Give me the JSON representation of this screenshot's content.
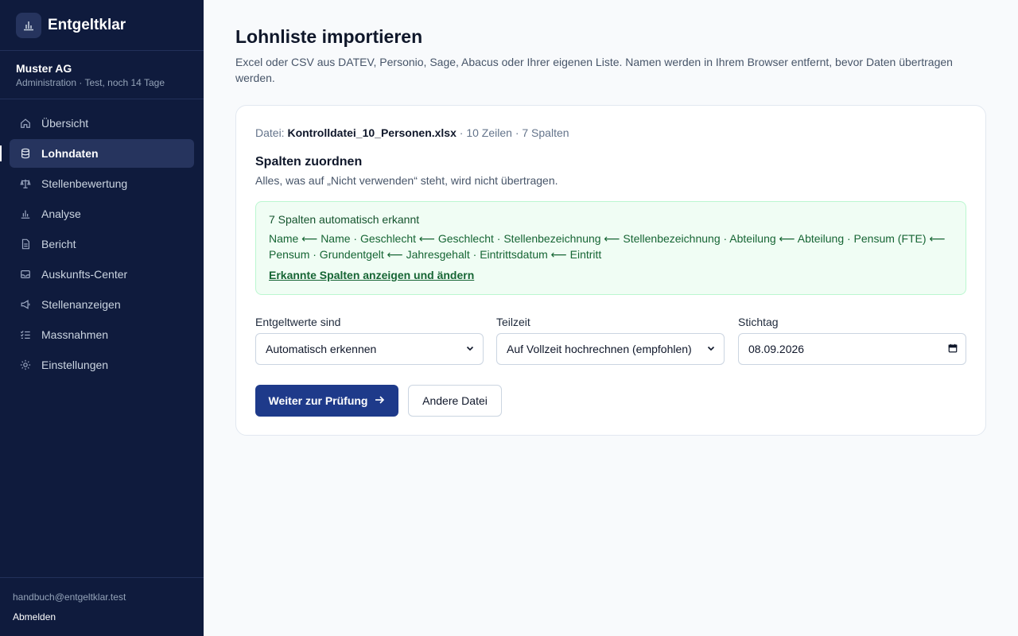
{
  "sidebar": {
    "brand": {
      "name": "Entgeltklar",
      "icon": "bar-chart-icon"
    },
    "org": {
      "name": "Muster AG",
      "subtitle": "Administration · Test, noch 14 Tage"
    },
    "items": [
      {
        "label": "Übersicht",
        "icon": "home-icon",
        "active": false
      },
      {
        "label": "Lohndaten",
        "icon": "database-icon",
        "active": true
      },
      {
        "label": "Stellenbewertung",
        "icon": "scale-icon",
        "active": false
      },
      {
        "label": "Analyse",
        "icon": "bar-chart-icon",
        "active": false
      },
      {
        "label": "Bericht",
        "icon": "document-icon",
        "active": false
      },
      {
        "label": "Auskunfts-Center",
        "icon": "inbox-icon",
        "active": false
      },
      {
        "label": "Stellenanzeigen",
        "icon": "megaphone-icon",
        "active": false
      },
      {
        "label": "Massnahmen",
        "icon": "checklist-icon",
        "active": false
      },
      {
        "label": "Einstellungen",
        "icon": "gear-icon",
        "active": false
      }
    ],
    "footer": {
      "email": "handbuch@entgeltklar.test",
      "logout": "Abmelden"
    }
  },
  "main": {
    "title": "Lohnliste importieren",
    "description": "Excel oder CSV aus DATEV, Personio, Sage, Abacus oder Ihrer eigenen Liste. Namen werden in Ihrem Browser entfernt, bevor Daten übertragen werden.",
    "file": {
      "prefix": "Datei:",
      "name": "Kontrolldatei_10_Personen.xlsx",
      "meta": "· 10 Zeilen · 7 Spalten"
    },
    "mapping": {
      "title": "Spalten zuordnen",
      "subtitle": "Alles, was auf „Nicht verwenden“ steht, wird nicht übertragen.",
      "detected_title": "7 Spalten automatisch erkannt",
      "detected_list": "Name ⟵ Name · Geschlecht ⟵ Geschlecht · Stellenbezeichnung ⟵ Stellenbezeichnung · Abteilung ⟵ Abteilung · Pensum (FTE) ⟵ Pensum · Grundentgelt ⟵ Jahresgehalt · Eintrittsdatum ⟵ Eintritt",
      "detected_link": "Erkannte Spalten anzeigen und ändern"
    },
    "fields": {
      "pay": {
        "label": "Entgeltwerte sind",
        "value": "Automatisch erkennen"
      },
      "parttime": {
        "label": "Teilzeit",
        "value": "Auf Vollzeit hochrechnen (empfohlen)"
      },
      "date": {
        "label": "Stichtag",
        "value": "08.09.2026"
      }
    },
    "actions": {
      "primary": "Weiter zur Prüfung",
      "secondary": "Andere Datei"
    }
  },
  "colors": {
    "sidebar_bg": "#0f1b3d",
    "primary": "#1e3a8a",
    "success_bg": "#f0fdf4",
    "success_text": "#166534"
  }
}
